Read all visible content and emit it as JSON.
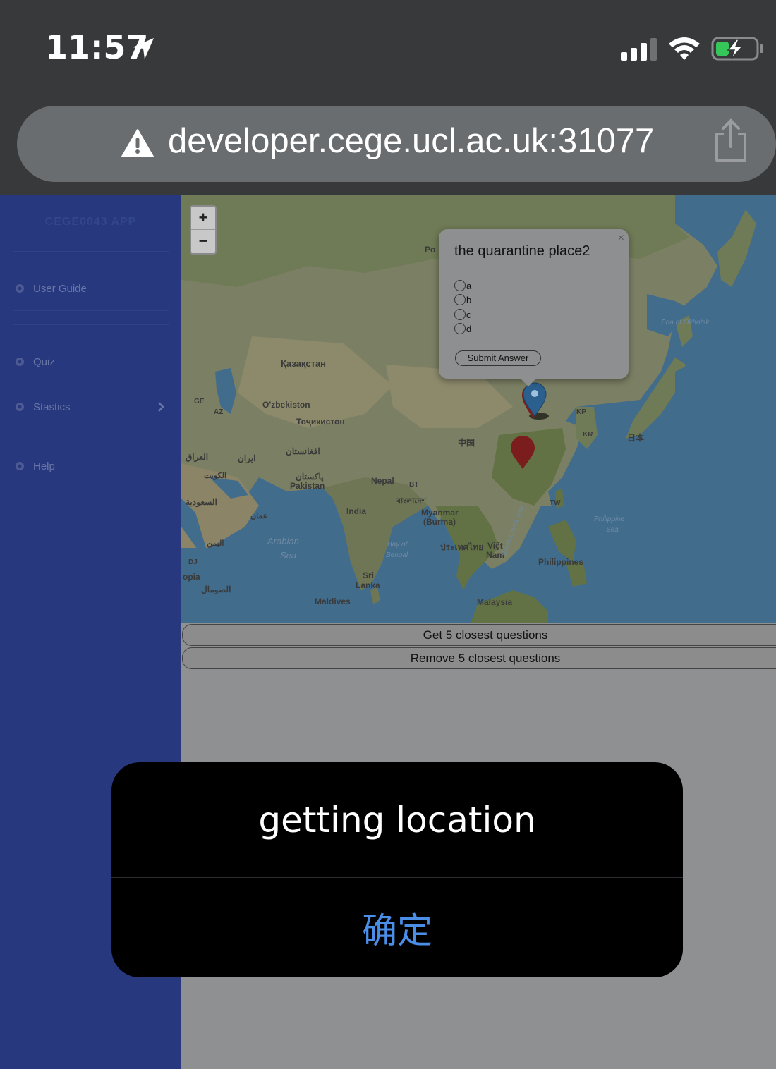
{
  "status_bar": {
    "time": "11:57",
    "icons": [
      "location-arrow-icon",
      "cellular-signal-icon",
      "wifi-icon",
      "battery-charging-icon"
    ]
  },
  "url_bar": {
    "url": "developer.cege.ucl.ac.uk:31077",
    "icons": [
      "warning-icon",
      "share-icon"
    ]
  },
  "sidebar": {
    "brand": "CEGE0043 APP",
    "items": [
      {
        "label": "User Guide",
        "icon": "gear-icon"
      },
      {
        "label": "Quiz",
        "icon": "gear-icon"
      },
      {
        "label": "Stastics",
        "icon": "gear-icon",
        "has_submenu": true
      },
      {
        "label": "Help",
        "icon": "gear-icon"
      }
    ]
  },
  "map": {
    "zoom_in": "+",
    "zoom_out": "−",
    "labels": {
      "kazakhstan": "Қазақстан",
      "uzbekistan": "O'zbekiston",
      "tajikistan": "Тоҷикистон",
      "afghanistan": "افغانستان",
      "iran": "ایران",
      "iraq": "العراق",
      "kuwait": "الكويت",
      "saudi": "السعودية",
      "oman": "عمان",
      "yemen": "اليمن",
      "pakistan_ar": "پاکستان",
      "pakistan": "Pakistan",
      "nepal": "Nepal",
      "bhutan": "BT",
      "bangladesh": "বাংলাদেশ",
      "india": "India",
      "myanmar": "Myanmar",
      "burma": "(Burma)",
      "thailand": "ประเทศไทย",
      "vietnam": "Việt",
      "nam": "Nam",
      "china": "中国",
      "north_korea": "KP",
      "south_korea": "KR",
      "japan": "日本",
      "taiwan": "TW",
      "philippines": "Philippines",
      "malaysia": "Malaysia",
      "sri": "Sri",
      "lanka": "Lanka",
      "maldives": "Maldives",
      "georgia": "GE",
      "azerbaijan": "AZ",
      "djibouti": "DJ",
      "ethiopia": "opia",
      "somalia": "الصومال",
      "arabian_sea_1": "Arabian",
      "arabian_sea_2": "Sea",
      "bay_of_1": "Bay of",
      "bay_of_2": "Bengal",
      "south_china_sea": "South China Sea",
      "philippine_sea_1": "Philippine",
      "philippine_sea_2": "Sea",
      "okhotsk": "Sea of Okhotsk",
      "po": "Po",
      "partial": "ylh"
    }
  },
  "popup": {
    "title": "the quarantine place2",
    "close": "×",
    "options": [
      "a",
      "b",
      "c",
      "d"
    ],
    "submit": "Submit Answer"
  },
  "buttons": {
    "get_closest": "Get 5 closest questions",
    "remove_closest": "Remove 5 closest questions"
  },
  "alert": {
    "message": "getting location",
    "ok": "确定"
  }
}
